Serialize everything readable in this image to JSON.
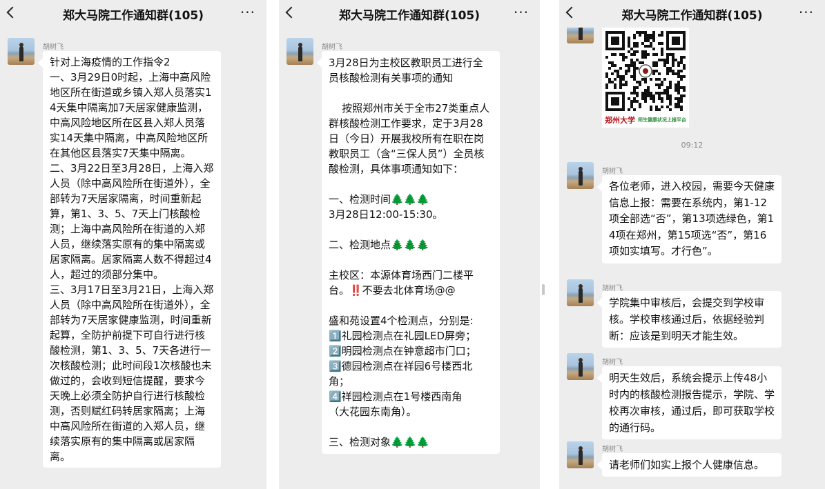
{
  "chat": {
    "title": "郑大马院工作通知群(105)",
    "more_label": "···",
    "sender_name": "胡树飞"
  },
  "panel1": {
    "message": "针对上海疫情的工作指令2\n一、3月29日0时起，上海中高风险地区所在街道或乡镇入郑人员落实14天集中隔离加7天居家健康监测，中高风险地区所在区县入郑人员落实14天集中隔离，中高风险地区所在其他区县落实7天集中隔离。\n二、3月22日至3月28日，上海入郑人员（除中高风险所在街道外），全部转为7天居家隔离，时间重新起算，第1、3、5、7天上门核酸检测；上海中高风险所在街道的入郑人员，继续落实原有的集中隔离或居家隔离。居家隔离人数不得超过4人，超过的须部分集中。\n三、3月17日至3月21日，上海入郑人员（除中高风险所在街道外），全部转为7天居家健康监测，时间重新起算，全防护前提下可自行进行核酸检测，第1、3、5、7天各进行一次核酸检测；此时间段1次核酸也未做过的，会收到短信提醒，要求今天晚上必须全防护自行进行核酸检测，否则赋红码转居家隔离；上海中高风险所在街道的入郑人员，继续落实原有的集中隔离或居家隔离。"
  },
  "panel2": {
    "message": "3月28日为主校区教职员工进行全员核酸检测有关事项的通知\n\n    按照郑州市关于全市27类重点人群核酸检测工作要求，定于3月28日（今日）开展我校所有在职在岗教职员工（含“三保人员”）全员核酸检测，具体事项通知如下：\n\n一、检测时间🌲🌲🌲\n3月28日12:00-15:30。\n\n二、检测地点🌲🌲🌲\n\n主校区：本源体育场西门二楼平台。‼️不要去北体育场@@\n\n盛和苑设置4个检测点，分别是:\n1️⃣礼园检测点在礼园LED屏旁；\n2️⃣明园检测点在钟意超市门口；\n3️⃣德园检测点在祥园6号楼西北角；\n4️⃣祥园检测点在1号楼西南角\n（大花园东南角）。\n\n三、检测对象🌲🌲🌲"
  },
  "panel3": {
    "qr_logo": "郑州大学",
    "qr_subtitle": "师生健康状况上报平台",
    "time": "09:12",
    "messages": [
      "各位老师，进入校园，需要今天健康信息上报：需要在系统内，第1-12项全部选“否”，第13项选绿色，第14项在郑州，第15项选“否”，第16项如实填写。才行色”。",
      "学院集中审核后，会提交到学校审核。学校审核通过后，依据经验判断：应该是到明天才能生效。",
      "明天生效后，系统会提示上传48小时内的核酸检测报告提示，学院、学校再次审核，通过后，即可获取学校的通行码。",
      "请老师们如实上报个人健康信息。"
    ]
  },
  "colors": {
    "chat_background": "#ededed",
    "bubble": "#ffffff",
    "sender_text": "#8a8a8a",
    "qr_logo": "#b4161b",
    "qr_subtitle": "#2a8a3a"
  },
  "icons": [
    "back-chevron-icon",
    "more-dots-icon",
    "avatar-image",
    "qr-code-image"
  ]
}
